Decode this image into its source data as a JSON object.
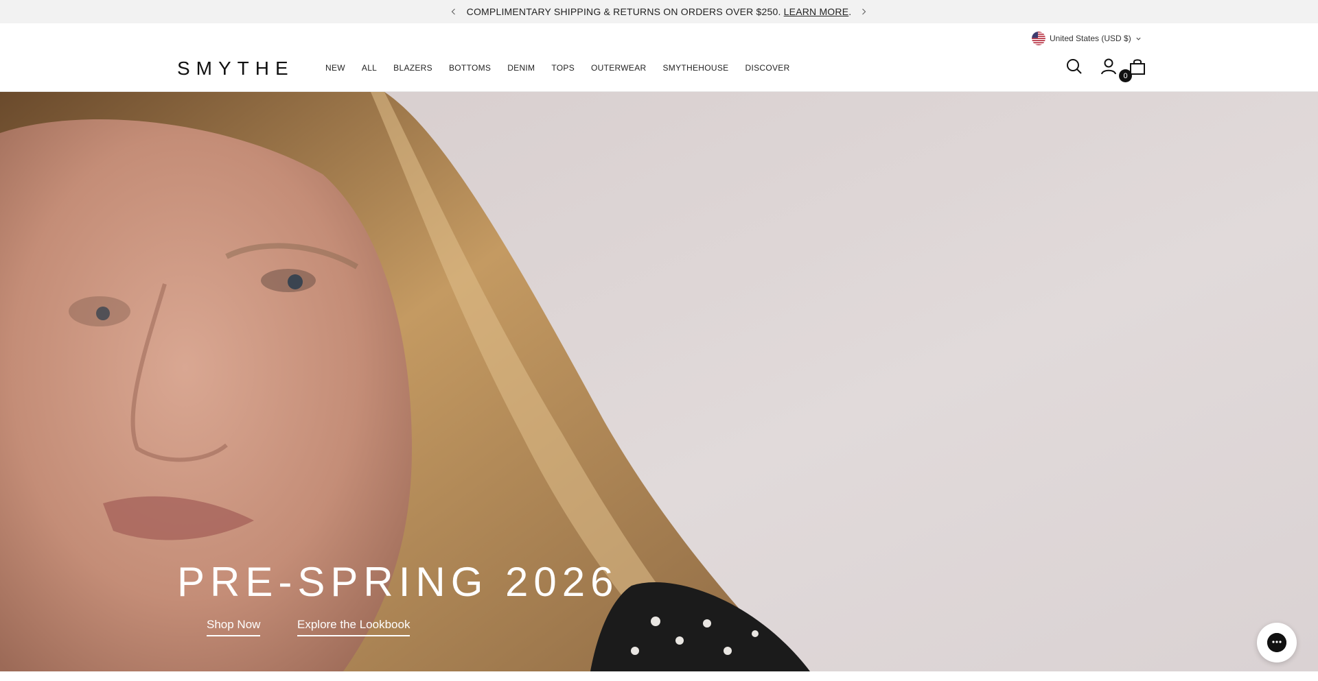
{
  "announcement": {
    "message": "COMPLIMENTARY SHIPPING & RETURNS ON ORDERS OVER $250. ",
    "link_label": "LEARN MORE",
    "trailing": "."
  },
  "header": {
    "locale_label": "United States (USD $)",
    "logo_text": "SMYTHE",
    "nav": [
      "NEW",
      "ALL",
      "BLAZERS",
      "BOTTOMS",
      "DENIM",
      "TOPS",
      "OUTERWEAR",
      "SMYTHEHOUSE",
      "DISCOVER"
    ],
    "cart_count": "0",
    "icons": [
      "search-icon",
      "account-icon",
      "shopping-bag-icon",
      "chevron-down-icon",
      "us-flag-icon",
      "chevron-left-icon",
      "chevron-right-icon"
    ]
  },
  "hero": {
    "title": "PRE-SPRING 2026",
    "cta_primary": "Shop Now",
    "cta_secondary": "Explore the Lookbook"
  },
  "chat": {
    "icon": "chat-icon"
  },
  "colors": {
    "announcement_bg": "#f2f2f2",
    "text": "#111111",
    "hero_text": "#ffffff"
  }
}
